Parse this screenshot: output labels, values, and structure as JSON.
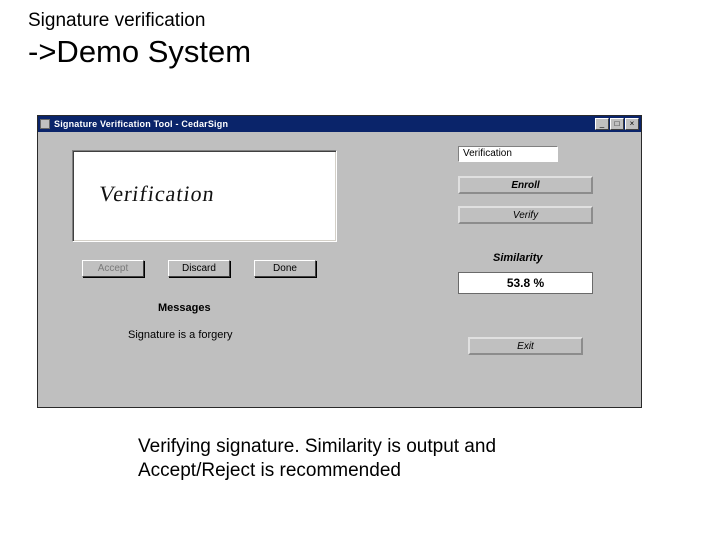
{
  "slide": {
    "overtitle": "Signature verification",
    "title": "->Demo System",
    "caption": "Verifying signature. Similarity is output and Accept/Reject is recommended"
  },
  "window": {
    "title": "Signature Verification Tool - CedarSign",
    "controls": {
      "minimize": "_",
      "maximize": "□",
      "close": "×"
    }
  },
  "signature": {
    "content": "Verification"
  },
  "buttons": {
    "accept": "Accept",
    "discard": "Discard",
    "done": "Done",
    "enroll": "Enroll",
    "verify": "Verify",
    "exit": "Exit"
  },
  "labels": {
    "verification_box": "Verification",
    "messages_header": "Messages",
    "messages_body": "Signature is a forgery",
    "similarity": "Similarity"
  },
  "values": {
    "similarity": "53.8 %"
  }
}
